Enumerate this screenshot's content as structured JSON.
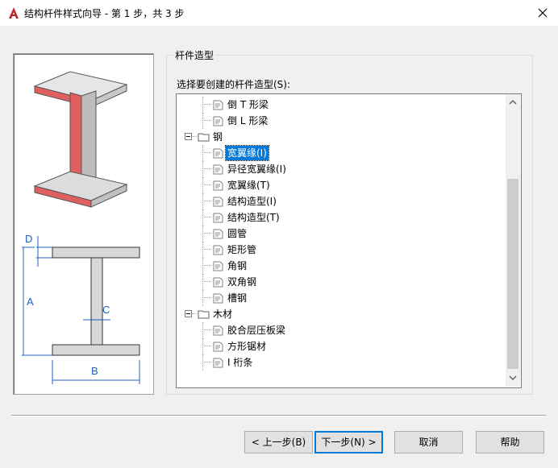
{
  "window": {
    "title": "结构杆件样式向导 - 第 1 步，共 3 步"
  },
  "group": {
    "legend": "杆件造型"
  },
  "tree": {
    "label": "选择要创建的杆件造型(S):",
    "nodes": [
      {
        "label": "倒 T 形梁",
        "type": "leaf"
      },
      {
        "label": "倒 L 形梁",
        "type": "leaf"
      },
      {
        "label": "钢",
        "type": "folder",
        "expanded": true
      },
      {
        "label": "宽翼缘(I)",
        "type": "leaf",
        "selected": true
      },
      {
        "label": "异径宽翼缘(I)",
        "type": "leaf"
      },
      {
        "label": "宽翼缘(T)",
        "type": "leaf"
      },
      {
        "label": "结构造型(I)",
        "type": "leaf"
      },
      {
        "label": "结构造型(T)",
        "type": "leaf"
      },
      {
        "label": "圆管",
        "type": "leaf"
      },
      {
        "label": "矩形管",
        "type": "leaf"
      },
      {
        "label": "角钢",
        "type": "leaf"
      },
      {
        "label": "双角钢",
        "type": "leaf"
      },
      {
        "label": "槽钢",
        "type": "leaf"
      },
      {
        "label": "木材",
        "type": "folder",
        "expanded": true
      },
      {
        "label": "胶合层压板梁",
        "type": "leaf"
      },
      {
        "label": "方形锯材",
        "type": "leaf"
      },
      {
        "label": "I 桁条",
        "type": "leaf"
      }
    ]
  },
  "preview": {
    "dim_labels": {
      "d": "D",
      "a": "A",
      "c": "C",
      "b": "B"
    }
  },
  "buttons": {
    "back": "< 上一步(B)",
    "next": "下一步(N) >",
    "cancel": "取消",
    "help": "帮助"
  },
  "colors": {
    "accent": "#0078d7",
    "flange_red": "#e06060",
    "app_icon": "#c0272d"
  }
}
